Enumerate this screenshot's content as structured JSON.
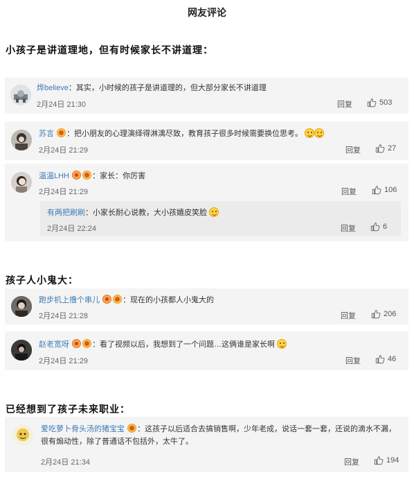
{
  "page_title": "网友评论",
  "sections": [
    {
      "heading": "小孩子是讲道理地，但有时候家长不讲道理：",
      "comments": [
        {
          "user": "烨believe",
          "text": "：其实，小时候的孩子是讲道理的，但大部分家长不讲道理",
          "time": "2月24日 21:30",
          "reply": "回复",
          "likes": "503"
        },
        {
          "user": "苏言",
          "text": "：把小朋友的心理演绎得淋漓尽致，教育孩子很多时候需要换位思考。",
          "time": "2月24日 21:29",
          "reply": "回复",
          "likes": "27"
        },
        {
          "user": "温温LHH",
          "text": "：家长：你厉害",
          "time": "2月24日 21:29",
          "reply": "回复",
          "likes": "106",
          "sub": {
            "user": "有两把刷刷",
            "text": "：小家长耐心说教，大小孩嬉皮笑脸",
            "time": "2月24日 22:24",
            "reply": "回复",
            "likes": "6"
          }
        }
      ]
    },
    {
      "heading": "孩子人小鬼大：",
      "comments": [
        {
          "user": "跑步机上撸个串儿",
          "text": "：现在的小孩都人小鬼大的",
          "time": "2月24日 21:28",
          "reply": "回复",
          "likes": "206"
        },
        {
          "user": "赵老宽呀",
          "text": "：看了视频以后，我想到了一个问题…这俩谁是家长啊",
          "time": "2月24日 21:29",
          "reply": "回复",
          "likes": "46"
        }
      ]
    },
    {
      "heading": "已经想到了孩子未来职业：",
      "comments": [
        {
          "user": "爱吃萝卜骨头汤的猪宝宝",
          "text": "：这孩子以后适合去搞销售啊，少年老成，说话一套一套，还说的滴水不漏，很有煽动性，除了普通话不包括外，太牛了。",
          "time": "2月24日 21:34",
          "reply": "回复",
          "likes": "194"
        }
      ]
    }
  ],
  "icons": {
    "like": "thumbs-up-icon",
    "vip_badge": "vip-badge-icon",
    "fans_badge": "fans-badge-icon",
    "emoji": "smile-emoji-icon"
  }
}
